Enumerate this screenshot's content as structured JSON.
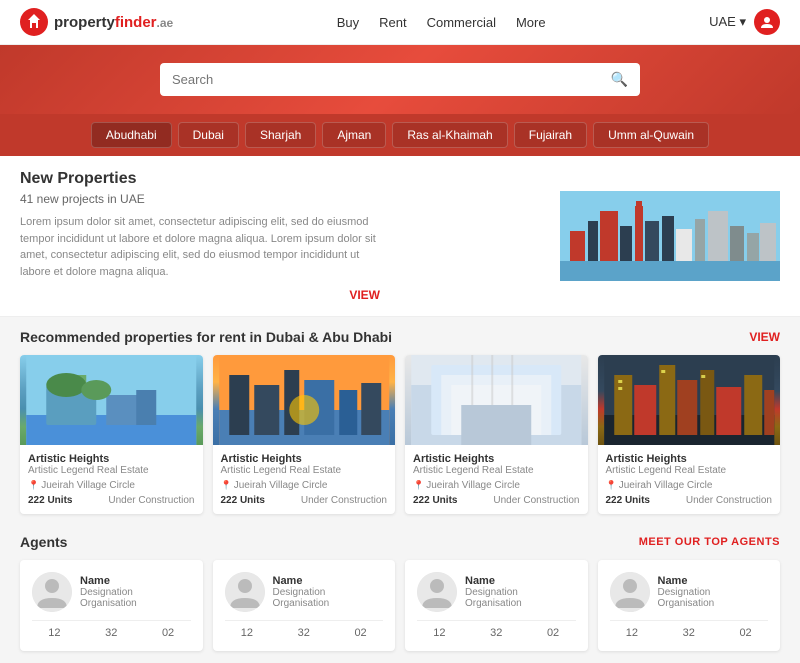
{
  "header": {
    "logo_text": "property",
    "logo_highlight": "finder",
    "logo_suffix": ".ae",
    "nav": [
      "Buy",
      "Rent",
      "Commercial",
      "More"
    ],
    "country": "UAE",
    "chevron": "▾"
  },
  "search": {
    "placeholder": "Search"
  },
  "cities": [
    "Abudhabi",
    "Dubai",
    "Sharjah",
    "Ajman",
    "Ras al-Khaimah",
    "Fujairah",
    "Umm al-Quwain"
  ],
  "banner": {
    "title": "New Properties",
    "subtitle": "41 new projects in UAE",
    "description": "Lorem ipsum dolor sit amet, consectetur adipiscing elit, sed do eiusmod tempor incididunt ut labore et dolore magna aliqua. Lorem ipsum dolor sit amet, consectetur adipiscing elit, sed do eiusmod tempor incididunt ut labore et dolore magna aliqua.",
    "view_label": "VIEW"
  },
  "recommended": {
    "title": "Recommended properties for rent in Dubai & Abu Dhabi",
    "view_label": "VIEW",
    "properties": [
      {
        "name": "Artistic Heights",
        "agency": "Artistic Legend Real Estate",
        "location": "Jueirah Village Circle",
        "units": "222 Units",
        "status": "Under Construction"
      },
      {
        "name": "Artistic Heights",
        "agency": "Artistic Legend Real Estate",
        "location": "Jueirah Village Circle",
        "units": "222 Units",
        "status": "Under Construction"
      },
      {
        "name": "Artistic Heights",
        "agency": "Artistic Legend Real Estate",
        "location": "Jueirah Village Circle",
        "units": "222 Units",
        "status": "Under Construction"
      },
      {
        "name": "Artistic Heights",
        "agency": "Artistic Legend Real Estate",
        "location": "Jueirah Village Circle",
        "units": "222 Units",
        "status": "Under Construction"
      }
    ]
  },
  "agents": {
    "title": "Agents",
    "meet_label": "MEET OUR TOP AGENTS",
    "list": [
      {
        "name": "Name",
        "designation": "Designation",
        "organisation": "Organisation",
        "stat1": "12",
        "stat2": "32",
        "stat3": "02"
      },
      {
        "name": "Name",
        "designation": "Designation",
        "organisation": "Organisation",
        "stat1": "12",
        "stat2": "32",
        "stat3": "02"
      },
      {
        "name": "Name",
        "designation": "Designation",
        "organisation": "Organisation",
        "stat1": "12",
        "stat2": "32",
        "stat3": "02"
      },
      {
        "name": "Name",
        "designation": "Designation",
        "organisation": "Organisation",
        "stat1": "12",
        "stat2": "32",
        "stat3": "02"
      }
    ]
  }
}
